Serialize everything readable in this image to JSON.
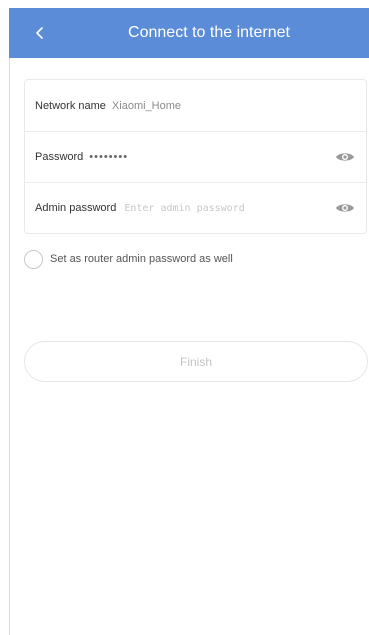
{
  "header": {
    "title": "Connect to the internet",
    "back_icon": "chevron-left-icon",
    "background_color": "#5b8cd7"
  },
  "form": {
    "network_name": {
      "label": "Network name",
      "value": "Xiaomi_Home"
    },
    "password": {
      "label": "Password",
      "value": "••••••••",
      "toggle_icon": "eye-icon"
    },
    "admin_password": {
      "label": "Admin password",
      "placeholder": "Enter admin password",
      "toggle_icon": "eye-icon"
    }
  },
  "checkbox": {
    "label": "Set as router admin password as well",
    "checked": false
  },
  "finish_button": {
    "label": "Finish",
    "enabled": false
  }
}
